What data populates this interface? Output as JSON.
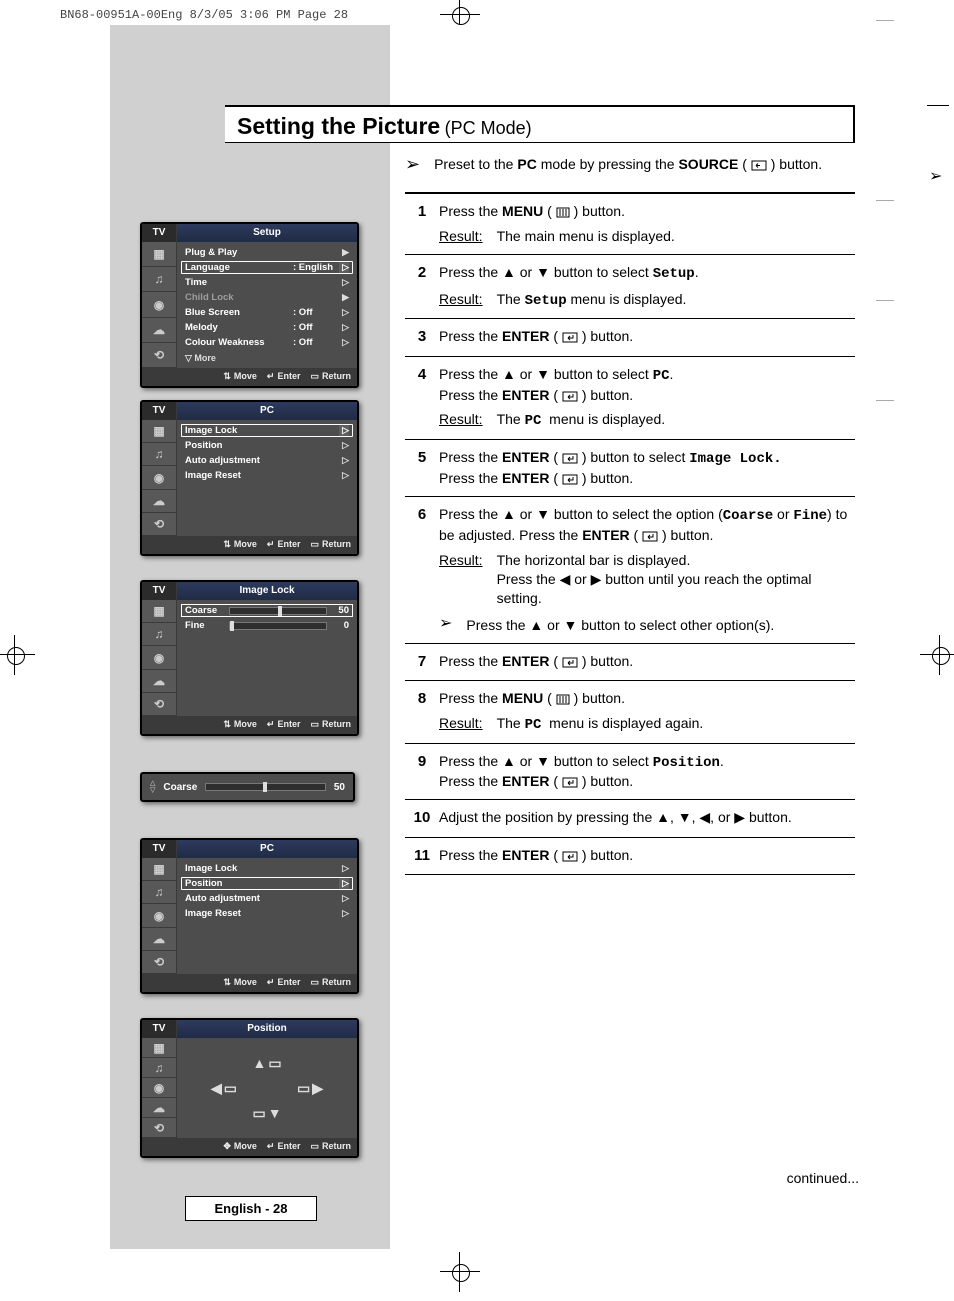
{
  "print_header": "BN68-00951A-00Eng  8/3/05  3:06 PM  Page 28",
  "title_main": "Setting the Picture",
  "title_sub": "(PC Mode)",
  "preset_before": "Preset to the ",
  "preset_bold1": "PC",
  "preset_mid": " mode by pressing the ",
  "preset_bold2": "SOURCE",
  "preset_after": " button.",
  "steps": [
    {
      "num": "1",
      "main": "Press the <b>MENU</b> ( <svg class='icon' width='14' height='11'><rect x='1' y='1' width='12' height='9' fill='none' stroke='#000'/><line x1='4' y1='2' x2='4' y2='9' stroke='#000'/><line x1='7' y1='2' x2='7' y2='9' stroke='#000'/><line x1='10' y1='2' x2='10' y2='9' stroke='#000'/></svg> ) button.",
      "result": "The main menu is displayed."
    },
    {
      "num": "2",
      "main": "Press the ▲ or ▼ button to select <span class='mono'>Setup</span>.",
      "result": "The <span class='mono'>Setup</span> menu is displayed."
    },
    {
      "num": "3",
      "main": "Press the <b>ENTER</b> ( <svg class='icon' width='16' height='11'><rect x='1' y='1' width='14' height='9' fill='none' stroke='#000'/><path d='M6 6 L11 6 L11 3' fill='none' stroke='#000'/><path d='M6 6 L8 4 M6 6 L8 8' stroke='#000'/></svg> ) button."
    },
    {
      "num": "4",
      "main": "Press the ▲ or ▼ button to select <span class='mono'>PC</span>.<br>Press the <b>ENTER</b> ( <svg class='icon' width='16' height='11'><rect x='1' y='1' width='14' height='9' fill='none' stroke='#000'/><path d='M6 6 L11 6 L11 3' fill='none' stroke='#000'/><path d='M6 6 L8 4 M6 6 L8 8' stroke='#000'/></svg> ) button.",
      "result": "The <span class='mono'>PC</span>&nbsp; menu is displayed."
    },
    {
      "num": "5",
      "main": "Press the <b>ENTER</b> ( <svg class='icon' width='16' height='11'><rect x='1' y='1' width='14' height='9' fill='none' stroke='#000'/><path d='M6 6 L11 6 L11 3' fill='none' stroke='#000'/><path d='M6 6 L8 4 M6 6 L8 8' stroke='#000'/></svg> ) button to select <span class='mono'>Image Lock.</span><br>Press the <b>ENTER</b> ( <svg class='icon' width='16' height='11'><rect x='1' y='1' width='14' height='9' fill='none' stroke='#000'/><path d='M6 6 L11 6 L11 3' fill='none' stroke='#000'/><path d='M6 6 L8 4 M6 6 L8 8' stroke='#000'/></svg> ) button."
    },
    {
      "num": "6",
      "main": "Press the ▲ or ▼ button to select the option (<span class='mono'>Coarse</span> or <span class='mono'>Fine</span>) to be adjusted. Press the <b>ENTER</b> ( <svg class='icon' width='16' height='11'><rect x='1' y='1' width='14' height='9' fill='none' stroke='#000'/><path d='M6 6 L11 6 L11 3' fill='none' stroke='#000'/><path d='M6 6 L8 4 M6 6 L8 8' stroke='#000'/></svg> ) button.",
      "result": "The horizontal bar is displayed.<br>Press the ◀ or ▶ button until you reach the optimal setting.",
      "sub": "Press the ▲ or ▼ button to select other option(s)."
    },
    {
      "num": "7",
      "main": "Press the <b>ENTER</b> ( <svg class='icon' width='16' height='11'><rect x='1' y='1' width='14' height='9' fill='none' stroke='#000'/><path d='M6 6 L11 6 L11 3' fill='none' stroke='#000'/><path d='M6 6 L8 4 M6 6 L8 8' stroke='#000'/></svg> ) button."
    },
    {
      "num": "8",
      "main": "Press the <b>MENU</b> ( <svg class='icon' width='14' height='11'><rect x='1' y='1' width='12' height='9' fill='none' stroke='#000'/><line x1='4' y1='2' x2='4' y2='9' stroke='#000'/><line x1='7' y1='2' x2='7' y2='9' stroke='#000'/><line x1='10' y1='2' x2='10' y2='9' stroke='#000'/></svg> ) button.",
      "result": "The <span class='mono'>PC</span>&nbsp; menu is displayed again."
    },
    {
      "num": "9",
      "main": "Press the ▲ or ▼ button to select <span class='mono'>Position</span>.<br>Press the <b>ENTER</b> ( <svg class='icon' width='16' height='11'><rect x='1' y='1' width='14' height='9' fill='none' stroke='#000'/><path d='M6 6 L11 6 L11 3' fill='none' stroke='#000'/><path d='M6 6 L8 4 M6 6 L8 8' stroke='#000'/></svg> ) button."
    },
    {
      "num": "10",
      "main": "Adjust the position by pressing the ▲, ▼, ◀, or ▶ button."
    },
    {
      "num": "11",
      "main": "Press the <b>ENTER</b> ( <svg class='icon' width='16' height='11'><rect x='1' y='1' width='14' height='9' fill='none' stroke='#000'/><path d='M6 6 L11 6 L11 3' fill='none' stroke='#000'/><path d='M6 6 L8 4 M6 6 L8 8' stroke='#000'/></svg> ) button."
    }
  ],
  "result_label": "Result:",
  "continued": "continued...",
  "page_footer": "English - 28",
  "osd": {
    "tv": "TV",
    "foot_move": "Move",
    "foot_enter": "Enter",
    "foot_return": "Return",
    "more": "▽ More",
    "setup": {
      "title": "Setup",
      "items": [
        {
          "label": "Plug & Play",
          "val": "",
          "arrow": "▶",
          "dim": false
        },
        {
          "label": "Language",
          "val": ": English",
          "arrow": "▷",
          "sel": true
        },
        {
          "label": "Time",
          "val": "",
          "arrow": "▷",
          "dim": false
        },
        {
          "label": "Child Lock",
          "val": "",
          "arrow": "▶",
          "dim": true
        },
        {
          "label": "Blue Screen",
          "val": ": Off",
          "arrow": "▷"
        },
        {
          "label": "Melody",
          "val": ": Off",
          "arrow": "▷"
        },
        {
          "label": "Colour Weakness",
          "val": ": Off",
          "arrow": "▷"
        }
      ]
    },
    "pc1": {
      "title": "PC",
      "items": [
        {
          "label": "Image Lock",
          "arrow": "▷",
          "sel": true
        },
        {
          "label": "Position",
          "arrow": "▷"
        },
        {
          "label": "Auto adjustment",
          "arrow": "▷"
        },
        {
          "label": "Image Reset",
          "arrow": "▷"
        }
      ]
    },
    "imglock": {
      "title": "Image Lock",
      "coarse_label": "Coarse",
      "coarse_val": "50",
      "fine_label": "Fine",
      "fine_val": "0"
    },
    "standalone": {
      "label": "Coarse",
      "val": "50"
    },
    "pc2": {
      "title": "PC",
      "items": [
        {
          "label": "Image Lock",
          "arrow": "▷"
        },
        {
          "label": "Position",
          "arrow": "▷",
          "sel": true
        },
        {
          "label": "Auto adjustment",
          "arrow": "▷"
        },
        {
          "label": "Image Reset",
          "arrow": "▷"
        }
      ]
    },
    "position": {
      "title": "Position"
    }
  }
}
